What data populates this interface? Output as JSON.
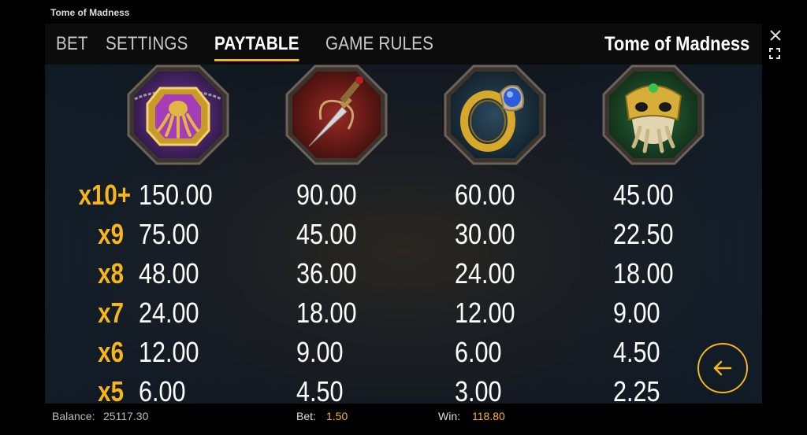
{
  "window": {
    "title": "Tome of Madness"
  },
  "tabs": [
    {
      "label": "BET"
    },
    {
      "label": "SETTINGS"
    },
    {
      "label": "PAYTABLE",
      "active": true
    },
    {
      "label": "GAME RULES"
    }
  ],
  "game_name": "Tome of Madness",
  "symbols": [
    {
      "name": "octopus-amulet",
      "payouts": [
        "150.00",
        "75.00",
        "48.00",
        "24.00",
        "12.00",
        "6.00"
      ]
    },
    {
      "name": "dagger",
      "payouts": [
        "90.00",
        "45.00",
        "36.00",
        "18.00",
        "9.00",
        "4.50"
      ]
    },
    {
      "name": "sapphire-ring",
      "payouts": [
        "60.00",
        "30.00",
        "24.00",
        "12.00",
        "6.00",
        "3.00"
      ]
    },
    {
      "name": "cthulhu-mask",
      "payouts": [
        "45.00",
        "22.50",
        "18.00",
        "9.00",
        "4.50",
        "2.25"
      ]
    }
  ],
  "multipliers": [
    "x10+",
    "x9",
    "x8",
    "x7",
    "x6",
    "x5"
  ],
  "footer": {
    "balance_label": "Balance:",
    "balance_value": "25117.30",
    "bet_label": "Bet:",
    "bet_value": "1.50",
    "win_label": "Win:",
    "win_value": "118.80"
  },
  "colors": {
    "accent": "#f6b51c",
    "background": "#000000"
  },
  "icons": {
    "close": "close-icon",
    "fullscreen": "fullscreen-icon",
    "back": "back-arrow-icon"
  }
}
